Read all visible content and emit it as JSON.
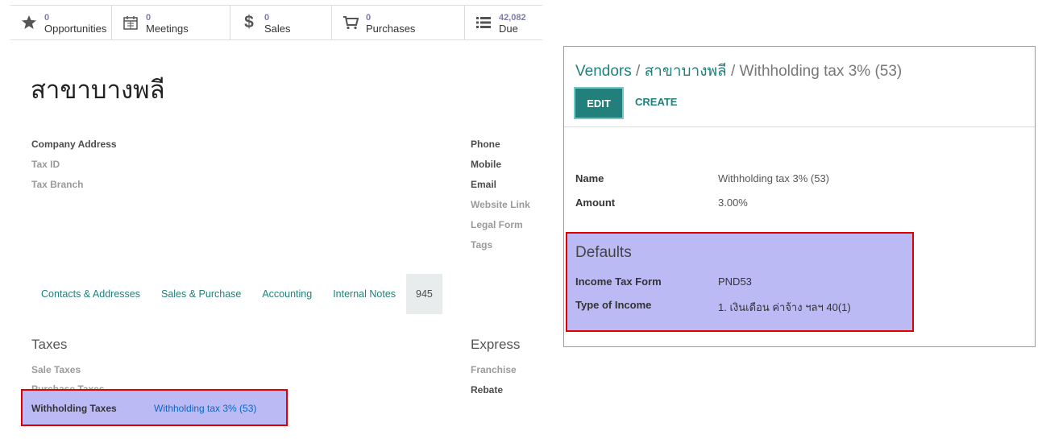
{
  "stat_buttons": [
    {
      "icon": "star-icon",
      "count": "0",
      "label": "Opportunities"
    },
    {
      "icon": "calendar-icon",
      "count": "0",
      "label": "Meetings"
    },
    {
      "icon": "dollar-icon",
      "count": "0",
      "label": "Sales"
    },
    {
      "icon": "cart-icon",
      "count": "0",
      "label": "Purchases"
    },
    {
      "icon": "list-icon",
      "count": "42,082",
      "label": "Due"
    }
  ],
  "partner": {
    "name": "สาขาบางพลี",
    "fields_left": [
      "Company Address",
      "Tax ID",
      "Tax Branch"
    ],
    "fields_right": [
      "Phone",
      "Mobile",
      "Email",
      "Website Link",
      "Legal Form",
      "Tags"
    ]
  },
  "tabs": [
    "Contacts & Addresses",
    "Sales & Purchase",
    "Accounting",
    "Internal Notes",
    "945"
  ],
  "taxes": {
    "heading": "Taxes",
    "sale_label": "Sale Taxes",
    "purchase_label": "Purchase Taxes",
    "withholding_label": "Withholding Taxes",
    "withholding_value": "Withholding tax 3% (53)"
  },
  "express": {
    "heading": "Express",
    "franchise_label": "Franchise",
    "rebate_label": "Rebate"
  },
  "tax_panel": {
    "breadcrumb": [
      "Vendors",
      "สาขาบางพลี",
      "Withholding tax 3% (53)"
    ],
    "breadcrumb_sep": "/",
    "edit_label": "EDIT",
    "create_label": "CREATE",
    "name_label": "Name",
    "name_value": "Withholding tax 3% (53)",
    "amount_label": "Amount",
    "amount_value": "3.00%",
    "defaults_heading": "Defaults",
    "income_tax_form_label": "Income Tax Form",
    "income_tax_form_value": "PND53",
    "type_of_income_label": "Type of Income",
    "type_of_income_value": "1. เงินเดือน ค่าจ้าง ฯลฯ 40(1)"
  },
  "colors": {
    "accent": "#21807c",
    "highlight": "#bcbaf5",
    "highlight_border": "#e00000",
    "count": "#7c7bad"
  }
}
